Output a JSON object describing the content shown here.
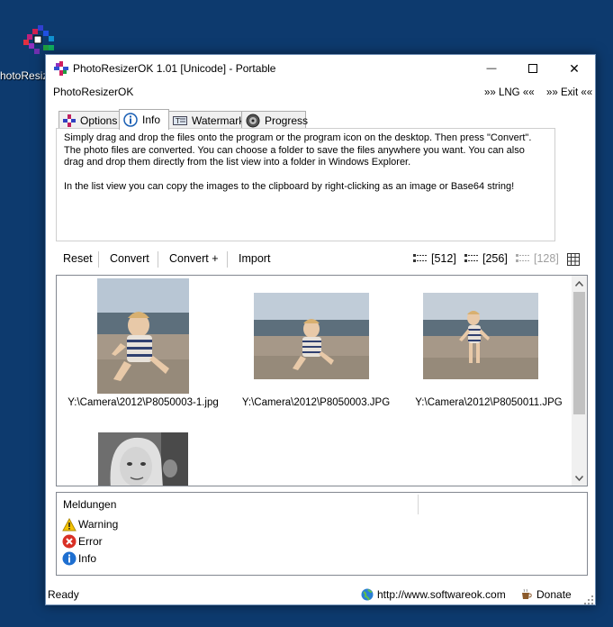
{
  "desktop": {
    "icon_label": "hotoResiz"
  },
  "window": {
    "title": "PhotoResizerOK 1.01 [Unicode] - Portable",
    "minimize": "—",
    "close": "✕"
  },
  "menubar": {
    "app_name": "PhotoResizerOK",
    "lng": "»» LNG ««",
    "exit": "»» Exit ««"
  },
  "tabs": [
    {
      "label": "Options",
      "icon": "options-icon"
    },
    {
      "label": "Info",
      "icon": "info-icon"
    },
    {
      "label": "Watermark",
      "icon": "watermark-icon"
    },
    {
      "label": "Progress",
      "icon": "progress-icon"
    }
  ],
  "info_panel": {
    "text": "Simply drag and drop the files onto the program or the program icon on the desktop. Then press \"Convert\".\nThe photo files are converted. You can choose a folder to save the files anywhere you want. You can also\ndrag and drop them directly from the list view into a folder in Windows Explorer.\n\nIn the list view you can copy the images to the clipboard by right-clicking as an image or Base64 string!"
  },
  "toolbar": {
    "reset": "Reset",
    "convert": "Convert",
    "convert_plus": "Convert +",
    "import": "Import",
    "size_512": "[512]",
    "size_256": "[256]",
    "size_128": "[128]"
  },
  "files": [
    {
      "name": "Y:\\Camera\\2012\\P8050003-1.jpg"
    },
    {
      "name": "Y:\\Camera\\2012\\P8050003.JPG"
    },
    {
      "name": "Y:\\Camera\\2012\\P8050011.JPG"
    },
    {
      "name": ""
    }
  ],
  "messages": {
    "header": "Meldungen",
    "warning": "Warning",
    "error": "Error",
    "info": "Info"
  },
  "statusbar": {
    "ready": "Ready",
    "url": "http://www.softwareok.com",
    "donate": "Donate"
  },
  "colors": {
    "desktop": "#0d3a6e",
    "accent": "#1e6fd0"
  }
}
